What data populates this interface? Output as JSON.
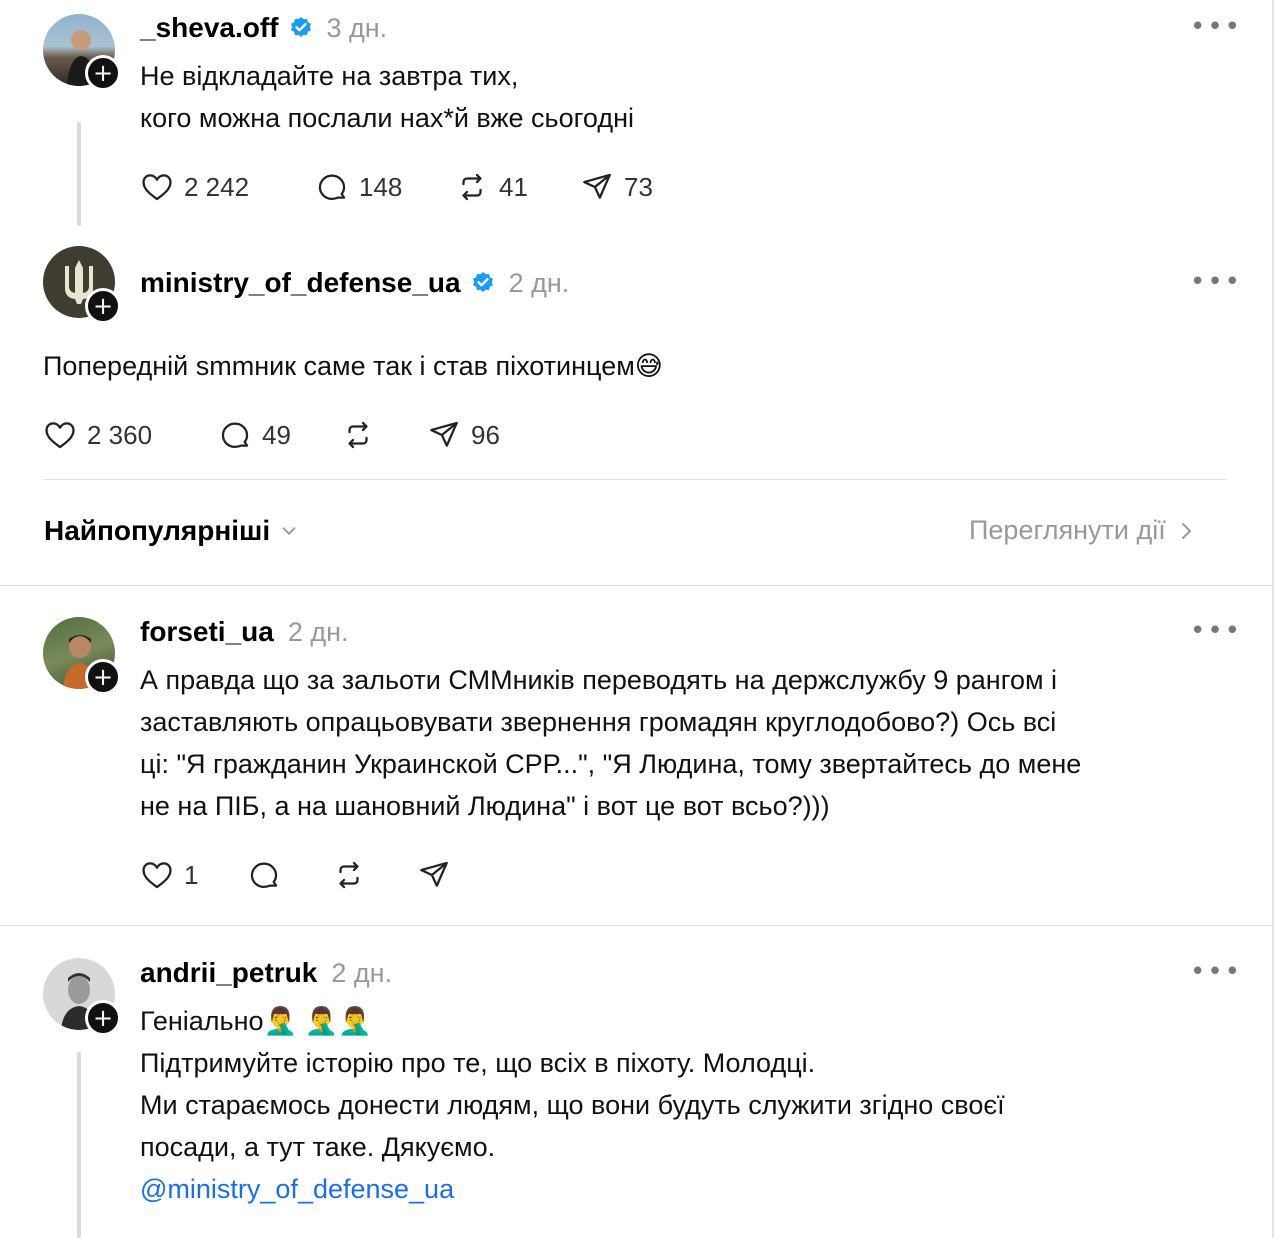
{
  "posts": [
    {
      "username": "_sheva.off",
      "verified": true,
      "time": "3 дн.",
      "text_lines": [
        "Не відкладайте на завтра тих,",
        "кого можна послали нах*й вже сьогодні"
      ],
      "likes": "2 242",
      "replies": "148",
      "reposts": "41",
      "shares": "73",
      "avatar_icon": "person-photo"
    },
    {
      "username": "ministry_of_defense_ua",
      "verified": true,
      "time": "2 дн.",
      "text": "Попередній smmник саме так і став піхотинцем😅",
      "likes": "2 360",
      "replies": "49",
      "reposts": "",
      "shares": "96",
      "avatar_icon": "trident-logo"
    }
  ],
  "sort": {
    "label": "Найпопулярніші"
  },
  "activity": {
    "label": "Переглянути дії"
  },
  "replies": [
    {
      "username": "forseti_ua",
      "time": "2 дн.",
      "text_lines": [
        "А правда що за зальоти СММників переводять на держслужбу 9 рангом і",
        "заставляють опрацьовувати звернення громадян круглодобово?) Ось всі",
        "ці: \"Я гражданин Украинской СРР...\", \"Я Людина, тому звертайтесь до мене",
        "не на ПІБ, а на шановний Людина\" і вот це вот всьо?)))"
      ],
      "likes": "1",
      "avatar_icon": "person-photo"
    },
    {
      "username": "andrii_petruk",
      "time": "2 дн.",
      "text_lines": [
        "Геніально🤦‍♂️ 🤦‍♂️🤦‍♂️",
        "Підтримуйте історію про те, що всіх в піхоту. Молодці.",
        "Ми стараємось донести людям, що вони будуть служити згідно своєї",
        "посади, а тут таке. Дякуємо."
      ],
      "mention": "@ministry_of_defense_ua",
      "avatar_icon": "person-photo"
    }
  ],
  "colors": {
    "verified": "#1d9bf0",
    "mention": "#1d6fe0",
    "muted": "#999999"
  }
}
